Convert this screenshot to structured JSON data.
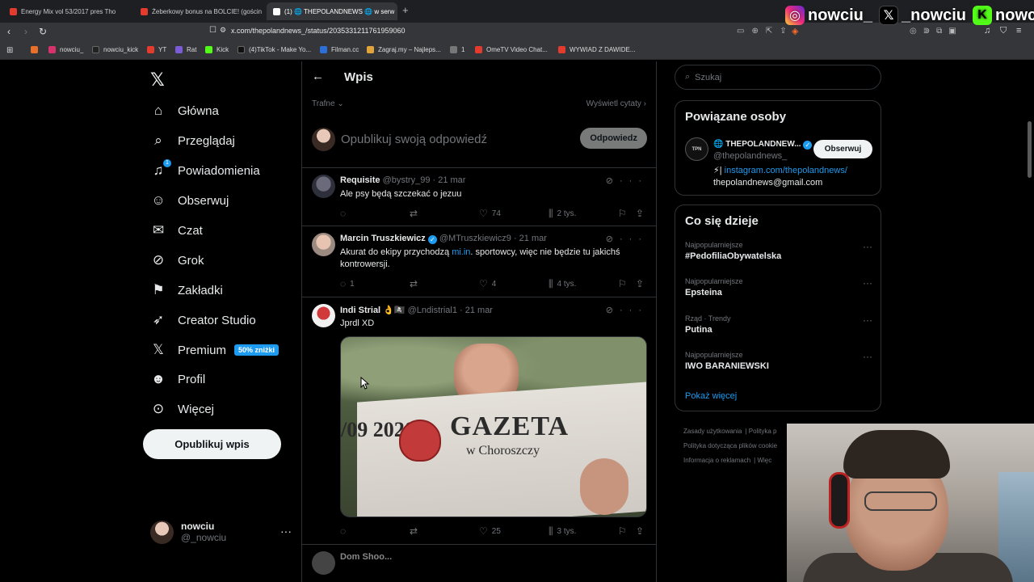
{
  "browser": {
    "tabs": [
      {
        "label": "Energy Mix vol 53/2017 pres Tho",
        "color": "#e33b2e",
        "active": false
      },
      {
        "label": "Żeberkowy bonus na BOLCIE! (gościn",
        "color": "#e33b2e",
        "active": false
      },
      {
        "label": "(1) 🌐 THEPOLANDNEWS 🌐 w serw",
        "color": "#ffffff",
        "active": true
      }
    ],
    "new_tab": "+",
    "url": "x.com/thepolandnews_/status/2035331211761959060",
    "bookmarks": [
      {
        "label": "",
        "color": "#e8702a"
      },
      {
        "label": "nowciu_",
        "color": "#d6336c"
      },
      {
        "label": "nowciu_kick",
        "color": "#222222"
      },
      {
        "label": "YT",
        "color": "#e33b2e"
      },
      {
        "label": "Rat",
        "color": "#7b5cd6"
      },
      {
        "label": "Kick",
        "color": "#53fc18"
      },
      {
        "label": "(4)TikTok - Make Yo...",
        "color": "#111111"
      },
      {
        "label": "Filman.cc",
        "color": "#2d6fd6"
      },
      {
        "label": "Zagraj.my – Najleps...",
        "color": "#e0a43a"
      },
      {
        "label": "1",
        "color": "#777777"
      },
      {
        "label": "OmeTV Video Chat...",
        "color": "#e33b2e"
      },
      {
        "label": "WYWIAD Z DAWIDE...",
        "color": "#e33b2e"
      }
    ]
  },
  "overlay": {
    "instagram": "nowciu_",
    "x": "_nowciu",
    "kick": "nowciu"
  },
  "nav": {
    "items": [
      {
        "label": "Główna",
        "icon": "home-icon",
        "glyph": "⌂"
      },
      {
        "label": "Przeglądaj",
        "icon": "search-icon",
        "glyph": "⌕"
      },
      {
        "label": "Powiadomienia",
        "icon": "bell-icon",
        "glyph": "🔔︎",
        "badge": "1"
      },
      {
        "label": "Obserwuj",
        "icon": "follow-icon",
        "glyph": "👤︎"
      },
      {
        "label": "Czat",
        "icon": "mail-icon",
        "glyph": "✉"
      },
      {
        "label": "Grok",
        "icon": "grok-icon",
        "glyph": "⊘"
      },
      {
        "label": "Zakładki",
        "icon": "bookmark-icon",
        "glyph": "🔖︎"
      },
      {
        "label": "Creator Studio",
        "icon": "rocket-icon",
        "glyph": "🚀︎"
      },
      {
        "label": "Premium",
        "icon": "x-premium-icon",
        "glyph": "𝕏",
        "promo": "50% zniżki"
      },
      {
        "label": "Profil",
        "icon": "profile-icon",
        "glyph": "👤︎"
      },
      {
        "label": "Więcej",
        "icon": "more-circle-icon",
        "glyph": "⊙"
      }
    ],
    "post_button": "Opublikuj wpis",
    "account": {
      "name": "nowciu",
      "handle": "@_nowciu"
    }
  },
  "center": {
    "title": "Wpis",
    "sort": "Trafne",
    "quotes": "Wyświetl cytaty",
    "reply_placeholder": "Opublikuj swoją odpowiedź",
    "reply_button": "Odpowiedz",
    "posts": [
      {
        "name": "Requisite",
        "handle": "@bystry_99",
        "date": "· 21 mar",
        "text": "Ale psy będą szczekać o jezuu",
        "replies": "",
        "likes": "74",
        "views": "2 tys."
      },
      {
        "name": "Marcin Truszkiewicz",
        "handle": "@MTruszkiewicz9",
        "date": "· 21 mar",
        "text_a": "Akurat do ekipy przychodzą ",
        "link": "mi.in",
        "text_b": ". sportowcy, więc nie będzie tu jakichś kontrowersji.",
        "replies": "1",
        "likes": "4",
        "views": "4 tys."
      },
      {
        "name": "Indi Strial 👌🏴‍☠️",
        "handle": "@Lndistrial1",
        "date": "· 21 mar",
        "text": "Jprdl XD",
        "media": {
          "headline": "GAZETA",
          "subline": "w Choroszczy",
          "year": "/09 2020"
        },
        "replies": "",
        "likes": "25",
        "views": "3 tys."
      }
    ],
    "next_post_partial": "Dom Shoo..."
  },
  "right": {
    "search_placeholder": "Szukaj",
    "related_title": "Powiązane osoby",
    "related": {
      "name": "🌐 THEPOLANDNEW...",
      "handle": "@thepolandnews_",
      "avatar_text": "TPN",
      "follow": "Obserwuj",
      "bio_prefix": "⚡| ",
      "bio_link": "instagram.com/thepolandnews/",
      "bio_email": "thepolandnews@gmail.com"
    },
    "trends_title": "Co się dzieje",
    "trends": [
      {
        "meta": "Najpopularniejsze",
        "name": "#PedofiliaObywatelska"
      },
      {
        "meta": "Najpopularniejsze",
        "name": "Epsteina"
      },
      {
        "meta": "Rząd · Trendy",
        "name": "Putina"
      },
      {
        "meta": "Najpopularniejsze",
        "name": "IWO BARANIEWSKI"
      }
    ],
    "show_more": "Pokaż więcej",
    "footer": [
      "Zasady użytkowania",
      "Polityka p",
      "Polityka dotycząca plików cookie",
      "Informacja o reklamach",
      "Więc"
    ]
  }
}
